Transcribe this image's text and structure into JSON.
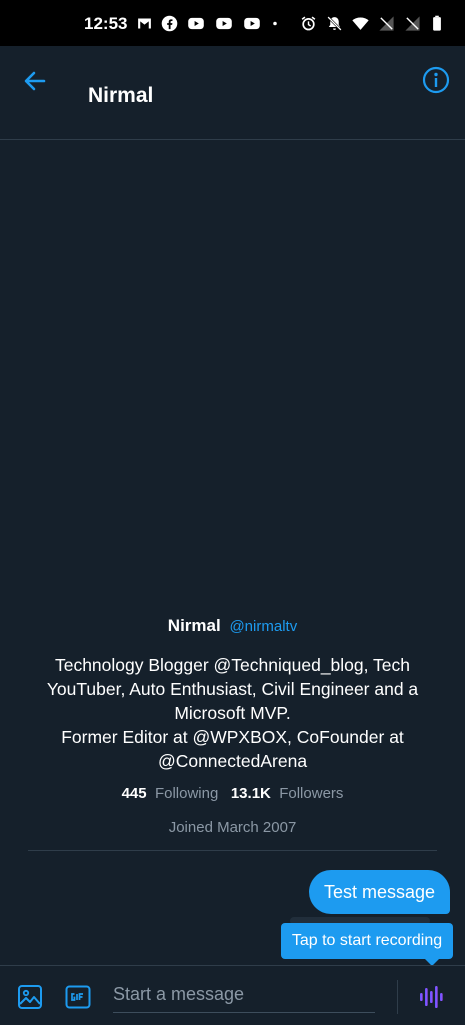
{
  "status_bar": {
    "time": "12:53",
    "left_icons": [
      "gmail-icon",
      "facebook-icon",
      "youtube-icon",
      "youtube-icon",
      "youtube-icon",
      "dot-icon"
    ],
    "right_icons": [
      "alarm-icon",
      "bell-off-icon",
      "wifi-icon",
      "no-signal-icon",
      "no-signal-icon",
      "battery-icon"
    ]
  },
  "header": {
    "title": "Nirmal",
    "back_icon": "arrow-left-icon",
    "info_icon": "info-icon"
  },
  "profile": {
    "name": "Nirmal",
    "handle": "@nirmaltv",
    "bio": "Technology Blogger @Techniqued_blog, Tech YouTuber, Auto Enthusiast, Civil Engineer and a Microsoft MVP.\nFormer Editor at @WPXBOX, CoFounder at @ConnectedArena",
    "following_count": "445",
    "following_label": "Following",
    "followers_count": "13.1K",
    "followers_label": "Followers",
    "joined": "Joined March 2007"
  },
  "messages": [
    {
      "text": "Test message",
      "direction": "outgoing"
    }
  ],
  "tooltip": {
    "text": "Tap to start recording"
  },
  "composer": {
    "placeholder": "Start a message",
    "media_icon": "image-icon",
    "gif_icon": "gif-icon",
    "voice_icon": "voice-record-icon"
  },
  "colors": {
    "background": "#15202b",
    "accent": "#1d9bf0",
    "secondary_text": "#8b98a5",
    "voice_accent": "#7856ff"
  }
}
